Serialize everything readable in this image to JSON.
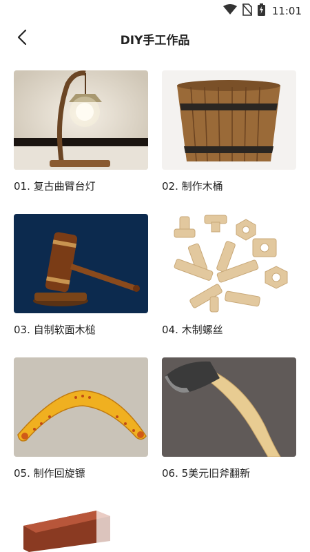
{
  "status_bar": {
    "time": "11:01",
    "icons": [
      "wifi-icon",
      "no-sim-icon",
      "battery-charging-icon"
    ]
  },
  "header": {
    "back_icon": "chevron-left-icon",
    "title": "DIY手工作品"
  },
  "items": [
    {
      "label": "01. 复古曲臂台灯",
      "image": "vintage-arm-lamp"
    },
    {
      "label": "02. 制作木桶",
      "image": "wooden-bucket"
    },
    {
      "label": "03. 自制软面木槌",
      "image": "wooden-mallet"
    },
    {
      "label": "04. 木制螺丝",
      "image": "wooden-screws"
    },
    {
      "label": "05. 制作回旋镖",
      "image": "boomerang"
    },
    {
      "label": "06. 5美元旧斧翻新",
      "image": "old-axe"
    },
    {
      "label": "",
      "image": "wooden-block"
    }
  ],
  "colors": {
    "text": "#222222",
    "background": "#ffffff"
  }
}
